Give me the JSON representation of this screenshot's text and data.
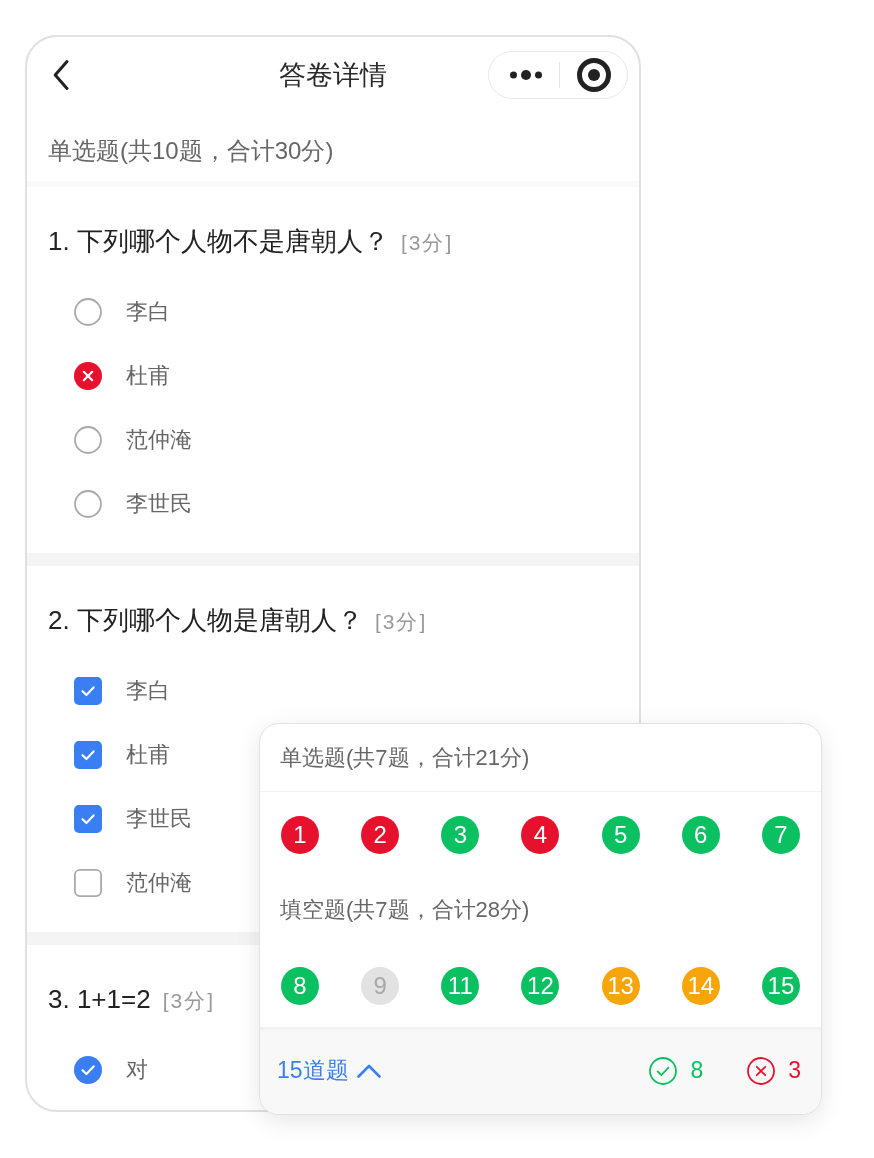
{
  "nav": {
    "title": "答卷详情"
  },
  "section": {
    "title": "单选题(共10题，合计30分)"
  },
  "questions": [
    {
      "title": "1. 下列哪个人物不是唐朝人？",
      "score": "[3分]",
      "kind": "radio",
      "correct": false,
      "options": [
        {
          "label": "李白",
          "selected": false
        },
        {
          "label": "杜甫",
          "selected": true
        },
        {
          "label": "范仲淹",
          "selected": false
        },
        {
          "label": "李世民",
          "selected": false
        }
      ]
    },
    {
      "title": "2. 下列哪个人物是唐朝人？",
      "score": "[3分]",
      "kind": "checkbox",
      "correct": true,
      "options": [
        {
          "label": "李白",
          "selected": true
        },
        {
          "label": "杜甫",
          "selected": true
        },
        {
          "label": "李世民",
          "selected": true
        },
        {
          "label": "范仲淹",
          "selected": false
        }
      ]
    },
    {
      "title": "3. 1+1=2",
      "score": "[3分]",
      "kind": "radio",
      "correct": true,
      "options": [
        {
          "label": "对",
          "selected": true
        }
      ]
    }
  ],
  "answer_sheet": {
    "groups": [
      {
        "title": "单选题(共7题，合计21分)",
        "items": [
          {
            "number": "1",
            "color": "#e8112d"
          },
          {
            "number": "2",
            "color": "#e8112d"
          },
          {
            "number": "3",
            "color": "#0ac060"
          },
          {
            "number": "4",
            "color": "#e8112d"
          },
          {
            "number": "5",
            "color": "#0ac060"
          },
          {
            "number": "6",
            "color": "#0ac060"
          },
          {
            "number": "7",
            "color": "#0ac060"
          }
        ]
      },
      {
        "title": "填空题(共7题，合计28分)",
        "items": [
          {
            "number": "8",
            "color": "#0ac060"
          },
          {
            "number": "9",
            "color": "#e2e2e2"
          },
          {
            "number": "11",
            "color": "#0ac060"
          },
          {
            "number": "12",
            "color": "#0ac060"
          },
          {
            "number": "13",
            "color": "#f7a50a"
          },
          {
            "number": "14",
            "color": "#f7a50a"
          },
          {
            "number": "15",
            "color": "#0ac060"
          }
        ]
      }
    ],
    "footer": {
      "toggle": "15道题",
      "expanded": true,
      "correct_count": "8",
      "wrong_count": "3"
    }
  }
}
